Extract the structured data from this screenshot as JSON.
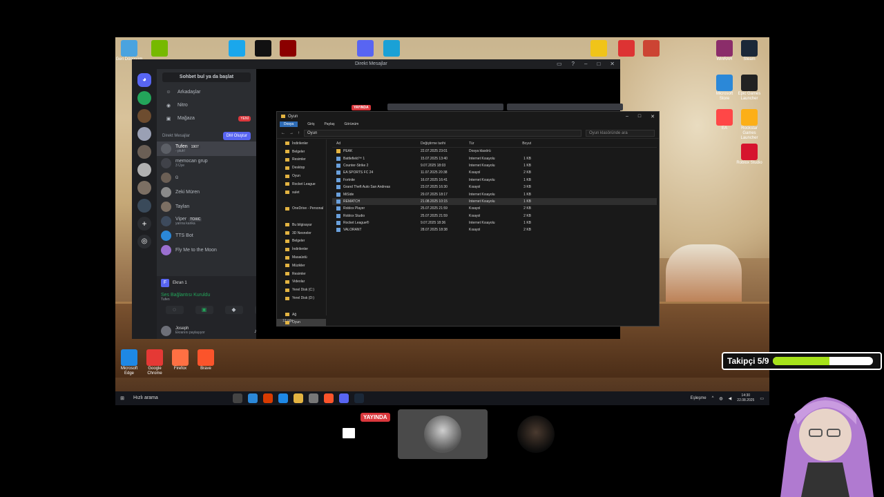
{
  "desktop": {
    "icons_top": [
      {
        "label": "Geri Dönüşüm",
        "color": "#4aa3df"
      },
      {
        "label": "",
        "color": "#76b900"
      },
      {
        "label": "",
        "color": "#1aa7ec"
      },
      {
        "label": "",
        "color": "#111111"
      },
      {
        "label": "",
        "color": "#8b0000"
      },
      {
        "label": "",
        "color": "#5865f2"
      },
      {
        "label": "",
        "color": "#1aa1d6"
      },
      {
        "label": "",
        "color": "#f0c419"
      },
      {
        "label": "",
        "color": "#d33"
      },
      {
        "label": "",
        "color": "#c43"
      }
    ],
    "icons_right": [
      {
        "label": "WinRAR",
        "color": "#8b2d6a"
      },
      {
        "label": "Steam",
        "color": "#1b2838"
      },
      {
        "label": "Microsoft Store",
        "color": "#2b88d8"
      },
      {
        "label": "Epic Games Launcher",
        "color": "#222222"
      },
      {
        "label": "EA",
        "color": "#ff4747"
      },
      {
        "label": "Rockstar Games Launcher",
        "color": "#fcaf17"
      },
      {
        "label": "Roblox Studio",
        "color": "#d6142e"
      }
    ],
    "icons_bottom": [
      {
        "label": "Microsoft Edge",
        "color": "#1e88e5"
      },
      {
        "label": "Google Chrome",
        "color": "#e53935"
      },
      {
        "label": "Firefox",
        "color": "#ff7043"
      },
      {
        "label": "Brave",
        "color": "#fb542b"
      }
    ]
  },
  "discord": {
    "window_title": "Direkt Mesajlar",
    "search_placeholder": "Sohbet bul ya da başlat",
    "nav": [
      {
        "icon": "friends-icon",
        "glyph": "☺",
        "label": "Arkadaşlar"
      },
      {
        "icon": "nitro-icon",
        "glyph": "◉",
        "label": "Nitro"
      },
      {
        "icon": "shop-icon",
        "glyph": "▣",
        "label": "Mağaza",
        "badge": "YENİ"
      }
    ],
    "dm_header": "Direkt Mesajlar",
    "dm_create": "DM Oluştur",
    "dms": [
      {
        "name": "Tufen",
        "sub": "- pluh!",
        "tag": "1907",
        "active": true
      },
      {
        "name": "memocan grup",
        "sub": "3 Üye",
        "tag": ""
      },
      {
        "name": "ü",
        "sub": "",
        "tag": ""
      },
      {
        "name": "Zeki Müren",
        "sub": "",
        "tag": ""
      },
      {
        "name": "Taylan",
        "sub": "",
        "tag": ""
      },
      {
        "name": "Viper",
        "sub": "yarına kanka",
        "tag": "TOXIC"
      },
      {
        "name": "TTS Bot",
        "sub": "",
        "tag": ""
      },
      {
        "name": "Fly Me to the Moon",
        "sub": "",
        "tag": ""
      }
    ],
    "screen_share_label": "Ekran 1",
    "voice_status": "Ses Bağlantısı Kuruldu",
    "voice_channel": "Tufen",
    "user": {
      "name": "Joseph",
      "status": "Ekranını paylaşıyor"
    },
    "live_label": "YAYINDA"
  },
  "explorer": {
    "title": "Oyun",
    "ribbon": [
      "Dosya",
      "Giriş",
      "Paylaş",
      "Görünüm"
    ],
    "path": "Oyun",
    "search_placeholder": "Oyun klasöründe ara",
    "nav": [
      {
        "label": "İndirilenler",
        "sel": false
      },
      {
        "label": "Belgeler",
        "sel": false
      },
      {
        "label": "Resimler",
        "sel": false
      },
      {
        "label": "Desktop",
        "sel": false
      },
      {
        "label": "Oyun",
        "sel": false
      },
      {
        "label": "Rocket League",
        "sel": false
      },
      {
        "label": "sulet",
        "sel": false
      },
      {
        "label": "",
        "sel": false
      },
      {
        "label": "OneDrive - Personal",
        "sel": false
      },
      {
        "label": "",
        "sel": false
      },
      {
        "label": "Bu bilgisayar",
        "sel": false
      },
      {
        "label": "3D Nesneler",
        "sel": false
      },
      {
        "label": "Belgeler",
        "sel": false
      },
      {
        "label": "İndirilenler",
        "sel": false
      },
      {
        "label": "Masaüstü",
        "sel": false
      },
      {
        "label": "Müzikler",
        "sel": false
      },
      {
        "label": "Resimler",
        "sel": false
      },
      {
        "label": "Videolar",
        "sel": false
      },
      {
        "label": "Yerel Disk (C:)",
        "sel": false
      },
      {
        "label": "Yerel Disk (D:)",
        "sel": false
      },
      {
        "label": "",
        "sel": false
      },
      {
        "label": "Ağ",
        "sel": false
      },
      {
        "label": "Oyun",
        "sel": true
      }
    ],
    "columns": {
      "name": "Ad",
      "date": "Değiştirme tarihi",
      "type": "Tür",
      "size": "Boyut"
    },
    "files": [
      {
        "name": "PEAK",
        "date": "22.07.2025 23:01",
        "type": "Dosya klasörü",
        "size": "",
        "folder": true
      },
      {
        "name": "Battlefield™ 1",
        "date": "15.07.2025 13:40",
        "type": "Internet Kısayolu",
        "size": "1 KB"
      },
      {
        "name": "Counter-Strike 2",
        "date": "9.07.2025 18:03",
        "type": "Internet Kısayolu",
        "size": "1 KB"
      },
      {
        "name": "EA SPORTS FC 24",
        "date": "11.07.2025 20:38",
        "type": "Kısayol",
        "size": "2 KB"
      },
      {
        "name": "Fortnite",
        "date": "16.07.2025 16:41",
        "type": "Internet Kısayolu",
        "size": "1 KB"
      },
      {
        "name": "Grand Theft Auto San Andreas",
        "date": "23.07.2025 16:30",
        "type": "Kısayol",
        "size": "3 KB"
      },
      {
        "name": "MiSide",
        "date": "29.07.2025 18:17",
        "type": "Internet Kısayolu",
        "size": "1 KB"
      },
      {
        "name": "REMATCH",
        "date": "21.08.2025 10:15",
        "type": "Internet Kısayolu",
        "size": "1 KB",
        "sel": true
      },
      {
        "name": "Roblox Player",
        "date": "25.07.2025 21:59",
        "type": "Kısayol",
        "size": "2 KB"
      },
      {
        "name": "Roblox Studio",
        "date": "25.07.2025 21:59",
        "type": "Kısayol",
        "size": "2 KB"
      },
      {
        "name": "Rocket League®",
        "date": "9.07.2025 18:36",
        "type": "Internet Kısayolu",
        "size": "1 KB"
      },
      {
        "name": "VALORANT",
        "date": "28.07.2025 18:38",
        "type": "Kısayol",
        "size": "2 KB"
      }
    ],
    "status": "12 öğe"
  },
  "taskbar": {
    "search_placeholder": "Hızlı arama",
    "apps": [
      "#444",
      "#2b88d8",
      "#d83b01",
      "#1e88e5",
      "#e3b341",
      "#777",
      "#fb542b",
      "#5865f2",
      "#1b2838"
    ],
    "tray_label": "Eşleşme",
    "time": "14:30",
    "date": "22.08.2025"
  },
  "call": {
    "live_label": "YAYINDA"
  },
  "overlay": {
    "follower_label": "Takipçi 5/9",
    "follower_progress": 0.56
  }
}
